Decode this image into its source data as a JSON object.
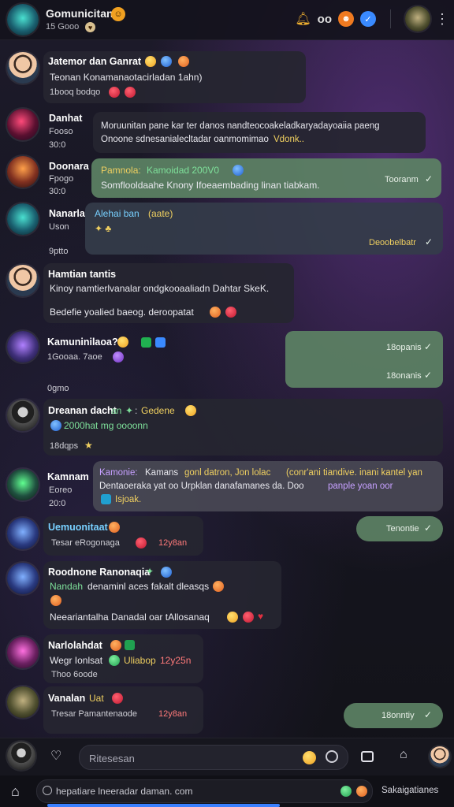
{
  "header": {
    "title": "Gomunicitan",
    "subtitle": "15 Gooo",
    "badge_count": "oo"
  },
  "messages": [
    {
      "name": "Jatemor dan Ganrat",
      "line1": "Teonan Konamanaotacirladan 1ahn)",
      "meta": "1booq bodqo"
    },
    {
      "side_name": "Danhat",
      "side_sub": "Fooso",
      "side_time": "30:0",
      "line1": "Moruunitan pane kar ter danos nandteocoakeladkaryadayoaiia paeng",
      "line2": "Onoone sdnesanialecltadar oanmomimao",
      "line2_hl": "Vdonk.."
    },
    {
      "side_name": "Doonara",
      "side_sub": "Fpogo",
      "side_time": "30:0",
      "hl": "Pamnola:",
      "hl2": "Kamoidad 200V0",
      "line2": "Somflooldaahe Knony Ifoeaembading linan tiabkam.",
      "time": "Tooranm"
    },
    {
      "side_name": "Nanarla",
      "side_sub": "Uson",
      "hl": "Alehai ban",
      "hl2": "(aate)",
      "time": "Deoobelbatr",
      "below": "9ptto"
    },
    {
      "name": "Hamtian tantis",
      "line1": "Kinoy namtierlvanalar ondgkooaaliadn Dahtar SkeK.",
      "line2": "Bedefie yoalied baeog. deroopatat"
    },
    {
      "name": "Kamuninilaoa?",
      "meta": "1Gooaa. 7aoe",
      "below": "0gmo",
      "out1": "18opanis",
      "out2": "18onanis"
    },
    {
      "name": "Dreanan dacht",
      "name_hl": "an",
      "name_hl2": "Gedene",
      "line1": "2000hat mg oooonn",
      "meta": "18dqps"
    },
    {
      "side_name": "Kamnam",
      "side_sub": "Eoreo",
      "side_time": "20:0",
      "hl": "Kamonie:",
      "line1": "Kamans",
      "line1_hl": "gonl datron, Jon lolac",
      "line1_rest": "(conr'ani tiandive. inani kantel yan",
      "line2": "Dentaoeraka yat oo Urpklan danafamanes da. Doo",
      "line2_hl": "panple yoan oor",
      "line3": "Isjoak."
    },
    {
      "name": "Uemuonitaat",
      "meta": "Tesar eRogonaga",
      "time": "12y8an",
      "out": "Tenontie"
    },
    {
      "name": "Roodnone Ranonaqia",
      "line1": "Nandah",
      "line1_rest": "denaminl aces fakalt dleasqs",
      "line2": "Neeariantalha Danadal oar tAllosanaq"
    },
    {
      "name": "Narlolahdat",
      "line1": "Wegr Ionlsat",
      "line1_hl": "Uliabop",
      "line1_time": "12y25n",
      "meta": "Thoo 6oode"
    },
    {
      "name": "Vanalan",
      "name_hl": "Uat",
      "meta": "Tresar Pamantenaode",
      "time": "12y8an",
      "out": "18onntiy"
    }
  ],
  "composer": {
    "placeholder": "Ritesesan"
  },
  "urlbar": {
    "url": "hepatiare lneeradar daman. com",
    "right": "Sakaigatianes"
  },
  "page": {
    "load_progress": 0.58
  },
  "colors": {
    "accent": "#5c8264",
    "background": "#171722",
    "bubble": "#262630",
    "highlight": "#f0d060"
  }
}
